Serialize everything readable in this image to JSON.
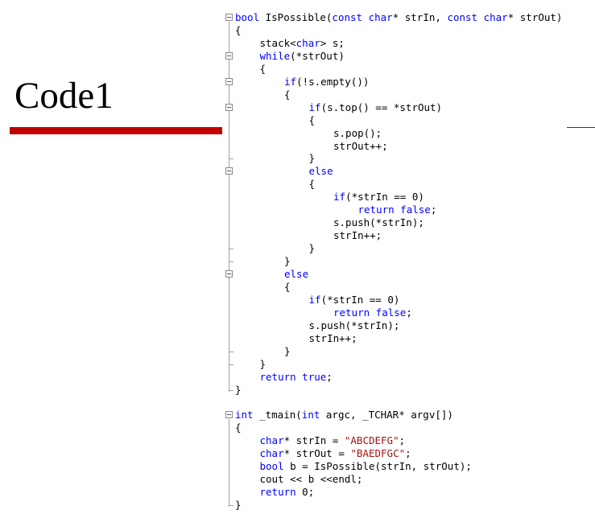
{
  "slide": {
    "title": "Code1"
  },
  "code": {
    "lines": [
      {
        "indent": 0,
        "tokens": [
          [
            "kw",
            "bool"
          ],
          [
            "t",
            " IsPossible("
          ],
          [
            "kw",
            "const"
          ],
          [
            "t",
            " "
          ],
          [
            "kw",
            "char"
          ],
          [
            "t",
            "* strIn, "
          ],
          [
            "kw",
            "const"
          ],
          [
            "t",
            " "
          ],
          [
            "kw",
            "char"
          ],
          [
            "t",
            "* strOut)"
          ]
        ]
      },
      {
        "indent": 0,
        "tokens": [
          [
            "t",
            "{"
          ]
        ]
      },
      {
        "indent": 1,
        "tokens": [
          [
            "t",
            "stack<"
          ],
          [
            "kw",
            "char"
          ],
          [
            "t",
            "> s;"
          ]
        ]
      },
      {
        "indent": 1,
        "tokens": [
          [
            "kw",
            "while"
          ],
          [
            "t",
            "(*strOut)"
          ]
        ]
      },
      {
        "indent": 1,
        "tokens": [
          [
            "t",
            "{"
          ]
        ]
      },
      {
        "indent": 2,
        "tokens": [
          [
            "kw",
            "if"
          ],
          [
            "t",
            "(!s.empty())"
          ]
        ]
      },
      {
        "indent": 2,
        "tokens": [
          [
            "t",
            "{"
          ]
        ]
      },
      {
        "indent": 3,
        "tokens": [
          [
            "kw",
            "if"
          ],
          [
            "t",
            "(s.top() == *strOut)"
          ]
        ]
      },
      {
        "indent": 3,
        "tokens": [
          [
            "t",
            "{"
          ]
        ]
      },
      {
        "indent": 4,
        "tokens": [
          [
            "t",
            "s.pop();"
          ]
        ]
      },
      {
        "indent": 4,
        "tokens": [
          [
            "t",
            "strOut++;"
          ]
        ]
      },
      {
        "indent": 3,
        "tokens": [
          [
            "t",
            "}"
          ]
        ]
      },
      {
        "indent": 3,
        "tokens": [
          [
            "kw",
            "else"
          ]
        ]
      },
      {
        "indent": 3,
        "tokens": [
          [
            "t",
            "{"
          ]
        ]
      },
      {
        "indent": 4,
        "tokens": [
          [
            "kw",
            "if"
          ],
          [
            "t",
            "(*strIn == 0)"
          ]
        ]
      },
      {
        "indent": 5,
        "tokens": [
          [
            "kw",
            "return false"
          ],
          [
            "t",
            ";"
          ]
        ]
      },
      {
        "indent": 4,
        "tokens": [
          [
            "t",
            "s.push(*strIn);"
          ]
        ]
      },
      {
        "indent": 4,
        "tokens": [
          [
            "t",
            "strIn++;"
          ]
        ]
      },
      {
        "indent": 3,
        "tokens": [
          [
            "t",
            "}"
          ]
        ]
      },
      {
        "indent": 2,
        "tokens": [
          [
            "t",
            "}"
          ]
        ]
      },
      {
        "indent": 2,
        "tokens": [
          [
            "kw",
            "else"
          ]
        ]
      },
      {
        "indent": 2,
        "tokens": [
          [
            "t",
            "{"
          ]
        ]
      },
      {
        "indent": 3,
        "tokens": [
          [
            "kw",
            "if"
          ],
          [
            "t",
            "(*strIn == 0)"
          ]
        ]
      },
      {
        "indent": 4,
        "tokens": [
          [
            "kw",
            "return false"
          ],
          [
            "t",
            ";"
          ]
        ]
      },
      {
        "indent": 3,
        "tokens": [
          [
            "t",
            "s.push(*strIn);"
          ]
        ]
      },
      {
        "indent": 3,
        "tokens": [
          [
            "t",
            "strIn++;"
          ]
        ]
      },
      {
        "indent": 2,
        "tokens": [
          [
            "t",
            "}"
          ]
        ]
      },
      {
        "indent": 1,
        "tokens": [
          [
            "t",
            "}"
          ]
        ]
      },
      {
        "indent": 1,
        "tokens": [
          [
            "kw",
            "return true"
          ],
          [
            "t",
            ";"
          ]
        ]
      },
      {
        "indent": 0,
        "tokens": [
          [
            "t",
            "}"
          ]
        ]
      },
      {
        "indent": 0,
        "tokens": [
          [
            "t",
            ""
          ]
        ]
      },
      {
        "indent": 0,
        "tokens": [
          [
            "kw",
            "int"
          ],
          [
            "t",
            " _tmain("
          ],
          [
            "kw",
            "int"
          ],
          [
            "t",
            " argc, _TCHAR* argv[])"
          ]
        ]
      },
      {
        "indent": 0,
        "tokens": [
          [
            "t",
            "{"
          ]
        ]
      },
      {
        "indent": 1,
        "tokens": [
          [
            "kw",
            "char"
          ],
          [
            "t",
            "* strIn = "
          ],
          [
            "str",
            "\"ABCDEFG\""
          ],
          [
            "t",
            ";"
          ]
        ]
      },
      {
        "indent": 1,
        "tokens": [
          [
            "kw",
            "char"
          ],
          [
            "t",
            "* strOut = "
          ],
          [
            "str",
            "\"BAEDFGC\""
          ],
          [
            "t",
            ";"
          ]
        ]
      },
      {
        "indent": 1,
        "tokens": [
          [
            "kw",
            "bool"
          ],
          [
            "t",
            " b = IsPossible(strIn, strOut);"
          ]
        ]
      },
      {
        "indent": 1,
        "tokens": [
          [
            "t",
            "cout << b <<endl;"
          ]
        ]
      },
      {
        "indent": 1,
        "tokens": [
          [
            "kw",
            "return"
          ],
          [
            "t",
            " 0;"
          ]
        ]
      },
      {
        "indent": 0,
        "tokens": [
          [
            "t",
            "}"
          ]
        ]
      }
    ]
  },
  "colors": {
    "keyword": "#0000ff",
    "string": "#a31515",
    "accent_bar": "#c00000"
  }
}
